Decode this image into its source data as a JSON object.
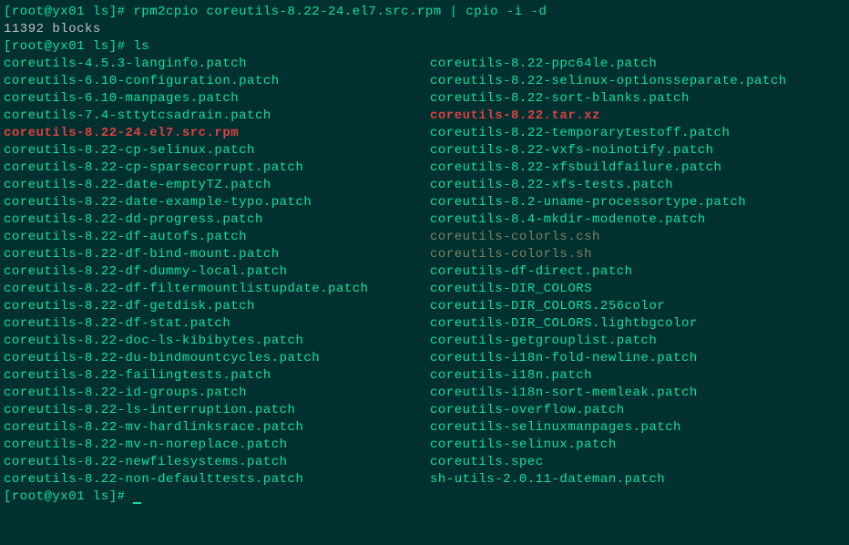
{
  "prompt1": "[root@yx01 ls]# ",
  "cmd1": "rpm2cpio coreutils-8.22-24.el7.src.rpm | cpio -i -d",
  "out1": "11392 blocks",
  "prompt2": "[root@yx01 ls]# ",
  "cmd2": "ls",
  "col1": [
    {
      "text": "coreutils-4.5.3-langinfo.patch",
      "cls": "cyan"
    },
    {
      "text": "coreutils-6.10-configuration.patch",
      "cls": "cyan"
    },
    {
      "text": "coreutils-6.10-manpages.patch",
      "cls": "cyan"
    },
    {
      "text": "coreutils-7.4-sttytcsadrain.patch",
      "cls": "cyan"
    },
    {
      "text": "coreutils-8.22-24.el7.src.rpm",
      "cls": "red"
    },
    {
      "text": "coreutils-8.22-cp-selinux.patch",
      "cls": "cyan"
    },
    {
      "text": "coreutils-8.22-cp-sparsecorrupt.patch",
      "cls": "cyan"
    },
    {
      "text": "coreutils-8.22-date-emptyTZ.patch",
      "cls": "cyan"
    },
    {
      "text": "coreutils-8.22-date-example-typo.patch",
      "cls": "cyan"
    },
    {
      "text": "coreutils-8.22-dd-progress.patch",
      "cls": "cyan"
    },
    {
      "text": "coreutils-8.22-df-autofs.patch",
      "cls": "cyan"
    },
    {
      "text": "coreutils-8.22-df-bind-mount.patch",
      "cls": "cyan"
    },
    {
      "text": "coreutils-8.22-df-dummy-local.patch",
      "cls": "cyan"
    },
    {
      "text": "coreutils-8.22-df-filtermountlistupdate.patch",
      "cls": "cyan"
    },
    {
      "text": "coreutils-8.22-df-getdisk.patch",
      "cls": "cyan"
    },
    {
      "text": "coreutils-8.22-df-stat.patch",
      "cls": "cyan"
    },
    {
      "text": "coreutils-8.22-doc-ls-kibibytes.patch",
      "cls": "cyan"
    },
    {
      "text": "coreutils-8.22-du-bindmountcycles.patch",
      "cls": "cyan"
    },
    {
      "text": "coreutils-8.22-failingtests.patch",
      "cls": "cyan"
    },
    {
      "text": "coreutils-8.22-id-groups.patch",
      "cls": "cyan"
    },
    {
      "text": "coreutils-8.22-ls-interruption.patch",
      "cls": "cyan"
    },
    {
      "text": "coreutils-8.22-mv-hardlinksrace.patch",
      "cls": "cyan"
    },
    {
      "text": "coreutils-8.22-mv-n-noreplace.patch",
      "cls": "cyan"
    },
    {
      "text": "coreutils-8.22-newfilesystems.patch",
      "cls": "cyan"
    },
    {
      "text": "coreutils-8.22-non-defaulttests.patch",
      "cls": "cyan"
    }
  ],
  "col2": [
    {
      "text": "coreutils-8.22-ppc64le.patch",
      "cls": "cyan"
    },
    {
      "text": "coreutils-8.22-selinux-optionsseparate.patch",
      "cls": "cyan"
    },
    {
      "text": "coreutils-8.22-sort-blanks.patch",
      "cls": "cyan"
    },
    {
      "text": "coreutils-8.22.tar.xz",
      "cls": "red"
    },
    {
      "text": "coreutils-8.22-temporarytestoff.patch",
      "cls": "cyan"
    },
    {
      "text": "coreutils-8.22-vxfs-noinotify.patch",
      "cls": "cyan"
    },
    {
      "text": "coreutils-8.22-xfsbuildfailure.patch",
      "cls": "cyan"
    },
    {
      "text": "coreutils-8.22-xfs-tests.patch",
      "cls": "cyan"
    },
    {
      "text": "coreutils-8.2-uname-processortype.patch",
      "cls": "cyan"
    },
    {
      "text": "coreutils-8.4-mkdir-modenote.patch",
      "cls": "cyan"
    },
    {
      "text": "coreutils-colorls.csh",
      "cls": "dim"
    },
    {
      "text": "coreutils-colorls.sh",
      "cls": "dim"
    },
    {
      "text": "coreutils-df-direct.patch",
      "cls": "cyan"
    },
    {
      "text": "coreutils-DIR_COLORS",
      "cls": "cyan"
    },
    {
      "text": "coreutils-DIR_COLORS.256color",
      "cls": "cyan"
    },
    {
      "text": "coreutils-DIR_COLORS.lightbgcolor",
      "cls": "cyan"
    },
    {
      "text": "coreutils-getgrouplist.patch",
      "cls": "cyan"
    },
    {
      "text": "coreutils-i18n-fold-newline.patch",
      "cls": "cyan"
    },
    {
      "text": "coreutils-i18n.patch",
      "cls": "cyan"
    },
    {
      "text": "coreutils-i18n-sort-memleak.patch",
      "cls": "cyan"
    },
    {
      "text": "coreutils-overflow.patch",
      "cls": "cyan"
    },
    {
      "text": "coreutils-selinuxmanpages.patch",
      "cls": "cyan"
    },
    {
      "text": "coreutils-selinux.patch",
      "cls": "cyan"
    },
    {
      "text": "coreutils.spec",
      "cls": "cyan"
    },
    {
      "text": "sh-utils-2.0.11-dateman.patch",
      "cls": "cyan"
    }
  ],
  "prompt3": "[root@yx01 ls]# "
}
